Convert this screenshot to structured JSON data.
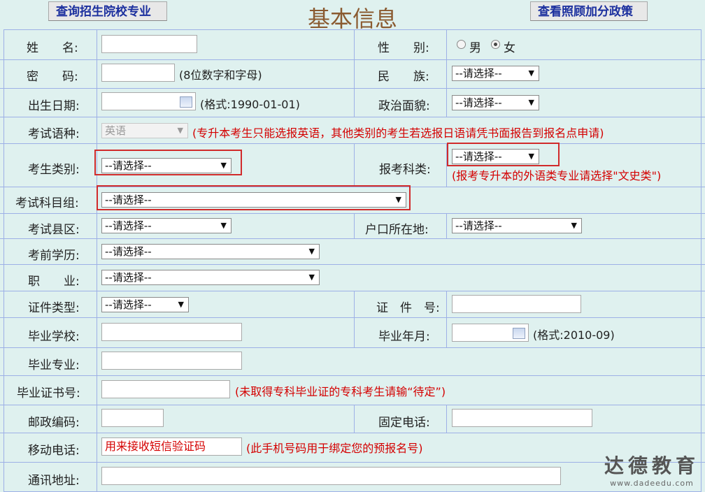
{
  "header": {
    "left_button": "查询招生院校专业",
    "title": "基本信息",
    "right_button": "查看照顾加分政策"
  },
  "form": {
    "name_label": "姓　　名:",
    "gender_label": "性　　别:",
    "gender_male": "男",
    "gender_female": "女",
    "password_label": "密　　码:",
    "password_hint": "(8位数字和字母)",
    "ethnicity_label": "民　　族:",
    "birth_label": "出生日期:",
    "birth_hint": "(格式:1990-01-01)",
    "political_label": "政治面貌:",
    "language_label": "考试语种:",
    "language_value": "英语",
    "language_note": "(专升本考生只能选报英语，其他类别的考生若选报日语请凭书面报告到报名点申请)",
    "category_label": "考生类别:",
    "subject_type_label": "报考科类:",
    "subject_type_note": "(报考专升本的外语类专业请选择\"文史类\")",
    "subject_group_label": "考试科目组:",
    "county_label": "考试县区:",
    "hukou_label": "户口所在地:",
    "education_label": "考前学历:",
    "job_label": "职　　业:",
    "idtype_label": "证件类型:",
    "idno_label": "证　件　号:",
    "school_label": "毕业学校:",
    "grad_date_label": "毕业年月:",
    "grad_date_hint": "(格式:2010-09)",
    "major_label": "毕业专业:",
    "cert_label": "毕业证书号:",
    "cert_note": "(未取得专科毕业证的专科考生请输“待定”)",
    "postal_label": "邮政编码:",
    "phone_label": "固定电话:",
    "mobile_label": "移动电话:",
    "mobile_placeholder": "用来接收短信验证码",
    "mobile_note": "(此手机号码用于绑定您的预报名号)",
    "address_label": "通讯地址:",
    "select_default": "--请选择--"
  },
  "watermark": {
    "brand": "达德教育",
    "url": "www.dadeedu.com"
  }
}
